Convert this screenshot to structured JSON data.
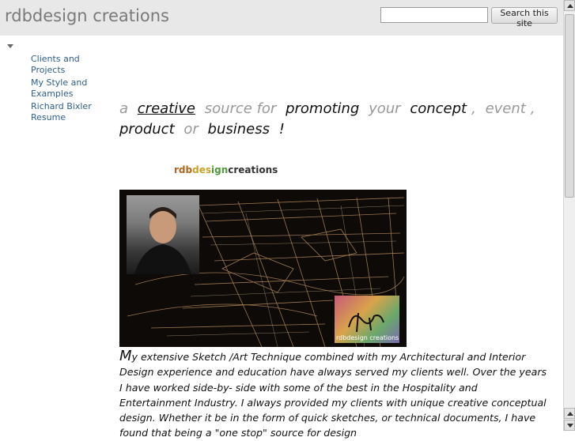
{
  "header": {
    "site_title": "rdbdesign creations",
    "search": {
      "value": "",
      "placeholder": ""
    },
    "search_button_label": "Search this site"
  },
  "sidebar": {
    "items": [
      {
        "label": "Clients and Projects"
      },
      {
        "label": "My Style and Examples"
      },
      {
        "label": "Richard Bixler Resume"
      }
    ]
  },
  "tagline": {
    "a": "a",
    "creative": "creative",
    "source_for": "source for",
    "promoting": "promoting",
    "your": "your",
    "concept": "concept",
    "comma1": ",",
    "event": "event",
    "comma2": ",",
    "product": "product",
    "or": "or",
    "business": "business",
    "bang": "!"
  },
  "brand": {
    "rdb": "rdb",
    "design": "design",
    "sign": "ign",
    "creations": "creations",
    "des": "des"
  },
  "hero": {
    "logo_text": "rdbdesign creations"
  },
  "body": {
    "dropcap": "M",
    "text": "y extensive Sketch /Art Technique combined with my Architectural and Interior Design experience and education have always served my clients well. Over the years I have worked side-by- side with some of the best in the  Hospitality and Entertainment Industry.  I always provided my clients with unique creative conceptual design.  Whether it be in the form of quick sketches, or  technical documents,  I have found that  being  a \"one stop\"  source  for design"
  },
  "colors": {
    "header_bg": "#e8e8e8",
    "link": "#2e5e8c",
    "title_gray": "#7a7a7a"
  }
}
